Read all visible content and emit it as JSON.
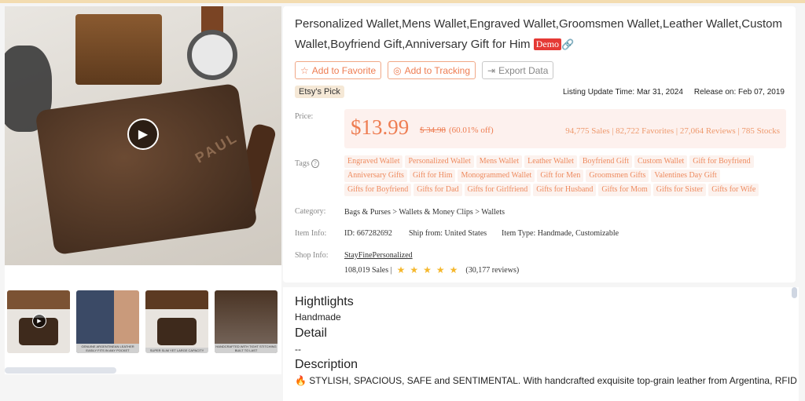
{
  "product": {
    "title": "Personalized Wallet,Mens Wallet,Engraved Wallet,Groomsmen Wallet,Leather Wallet,Custom Wallet,Boyfriend Gift,Anniversary Gift for Him",
    "demo_badge": "Demo",
    "engraving": "PAUL",
    "thumbnails": [
      {
        "caption": ""
      },
      {
        "caption": "GENUINE ARGENTINEAN LEATHER EASILY FITS IN ANY POCKET"
      },
      {
        "caption": "SUPER SLIM YET LARGE CAPACITY"
      },
      {
        "caption": "HANDCRAFTED WITH TIGHT STITCHING BUILT TO LAST"
      }
    ]
  },
  "actions": {
    "favorite": "Add to Favorite",
    "tracking": "Add to Tracking",
    "export": "Export Data"
  },
  "badge": "Etsy's Pick",
  "dates": {
    "update": "Listing Update Time: Mar 31, 2024",
    "release": "Release on: Feb 07, 2019"
  },
  "price": {
    "label": "Price:",
    "current": "$13.99",
    "original": "$ 34.98",
    "discount": "(60.01% off)",
    "stats": "94,775 Sales | 82,722 Favorites | 27,064 Reviews | 785 Stocks"
  },
  "tags": {
    "label": "Tags",
    "items": [
      "Engraved Wallet",
      "Personalized Wallet",
      "Mens Wallet",
      "Leather Wallet",
      "Boyfriend Gift",
      "Custom Wallet",
      "Gift for Boyfriend",
      "Anniversary Gifts",
      "Gift for Him",
      "Monogrammed Wallet",
      "Gift for Men",
      "Groomsmen Gifts",
      "Valentines Day Gift",
      "Gifts for Boyfriend",
      "Gifts for Dad",
      "Gifts for Girlfriend",
      "Gifts for Husband",
      "Gifts for Mom",
      "Gifts for Sister",
      "Gifts for Wife"
    ]
  },
  "category": {
    "label": "Category:",
    "path": "Bags & Purses  > Wallets & Money Clips > Wallets"
  },
  "item_info": {
    "label": "Item Info:",
    "id": "ID: 667282692",
    "ship": "Ship from: United States",
    "type": "Item Type: Handmade, Customizable"
  },
  "shop": {
    "label": "Shop Info:",
    "name": "StayFinePersonalized",
    "sales": "108,019 Sales |",
    "rating": 5,
    "reviews": "(30,177 reviews)"
  },
  "details": {
    "highlights_title": "Hightlights",
    "highlights": "Handmade",
    "detail_title": "Detail",
    "detail": "--",
    "description_title": "Description",
    "description": "🔥 STYLISH, SPACIOUS, SAFE and SENTIMENTAL. With handcrafted exquisite top-grain leather from Argentina, RFID blocking"
  },
  "colors": {
    "accent": "#ee7d52",
    "demo": "#e53935",
    "star": "#f5b82e"
  }
}
